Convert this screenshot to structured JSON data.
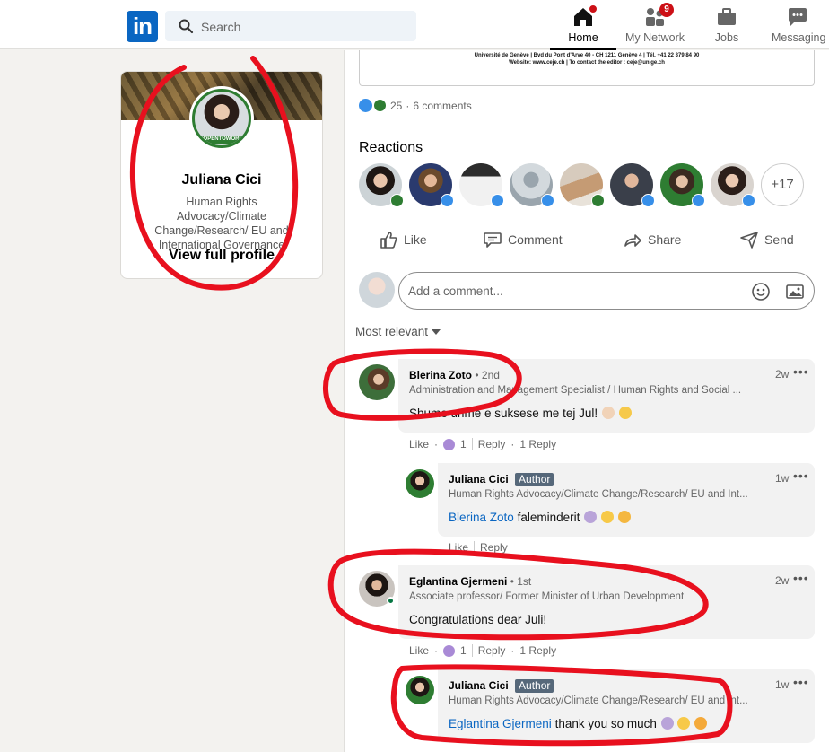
{
  "nav": {
    "search_placeholder": "Search",
    "items": [
      {
        "label": "Home",
        "badge": ""
      },
      {
        "label": "My Network",
        "badge": "9"
      },
      {
        "label": "Jobs",
        "badge": ""
      },
      {
        "label": "Messaging",
        "badge": ""
      }
    ]
  },
  "profile": {
    "name": "Juliana Cici",
    "headline": "Human Rights Advocacy/Climate Change/Research/ EU and International Governance",
    "view_profile": "View full profile",
    "frame_text": "#OPENTOWORK"
  },
  "post": {
    "doc_line_1": "Université de Genève | Bvd du Pont d'Arve 40 - CH 1211 Genève 4 | Tél. +41 22 379 84 90",
    "doc_line_2": "Website: www.ceje.ch | To contact the editor : ceje@unige.ch",
    "reaction_count": "25",
    "comment_count": "6 comments",
    "reactions_title": "Reactions",
    "more_reactors": "+17",
    "actions": {
      "like": "Like",
      "comment": "Comment",
      "share": "Share",
      "send": "Send"
    },
    "comment_placeholder": "Add a comment...",
    "sort_label": "Most relevant"
  },
  "comments": [
    {
      "name": "Blerina Zoto",
      "degree": "• 2nd",
      "subtitle": "Administration and Management Specialist / Human Rights and Social ...",
      "time": "2w",
      "text": "Shume urime e suksese me tej Jul!",
      "like": "Like",
      "reactions": "1",
      "reply": "Reply",
      "replies": "1 Reply",
      "reply_comment": {
        "name": "Juliana Cici",
        "author": "Author",
        "subtitle": "Human Rights Advocacy/Climate Change/Research/ EU and Int...",
        "time": "1w",
        "mention": "Blerina Zoto",
        "text": "faleminderit",
        "like": "Like",
        "reply": "Reply"
      }
    },
    {
      "name": "Eglantina Gjermeni",
      "degree": "• 1st",
      "subtitle": "Associate professor/ Former Minister of Urban Development",
      "time": "2w",
      "text": "Congratulations dear Juli!",
      "like": "Like",
      "reactions": "1",
      "reply": "Reply",
      "replies": "1 Reply",
      "reply_comment": {
        "name": "Juliana Cici",
        "author": "Author",
        "subtitle": "Human Rights Advocacy/Climate Change/Research/ EU and Int...",
        "time": "1w",
        "mention": "Eglantina Gjermeni",
        "text": "thank you so much"
      }
    }
  ],
  "colors": {
    "brand": "#0a66c2",
    "annotation": "#e8101e",
    "support_green": "#2e7d32",
    "like_blue": "#378fe9"
  }
}
